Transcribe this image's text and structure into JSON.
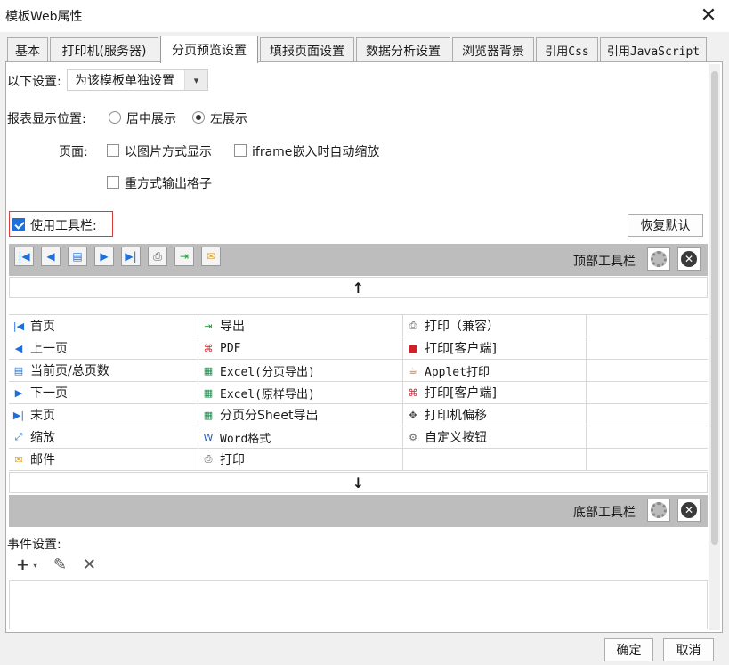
{
  "window": {
    "title": "模板Web属性",
    "close_symbol": "✕"
  },
  "tabs": [
    {
      "label": "基本"
    },
    {
      "label": "打印机(服务器)"
    },
    {
      "label": "分页预览设置",
      "active": true
    },
    {
      "label": "填报页面设置"
    },
    {
      "label": "数据分析设置"
    },
    {
      "label": "浏览器背景"
    },
    {
      "label": "引用Css"
    },
    {
      "label": "引用JavaScript"
    }
  ],
  "settings": {
    "scope_label": "以下设置:",
    "scope_value": "为该模板单独设置",
    "position_label": "报表显示位置:",
    "position_options": [
      "居中展示",
      "左展示"
    ],
    "position_selected": "左展示",
    "page_label": "页面:",
    "page_options": [
      "以图片方式显示",
      "iframe嵌入时自动缩放",
      "重方式输出格子"
    ],
    "use_toolbar_label": "使用工具栏:",
    "use_toolbar_checked": true,
    "restore_default": "恢复默认"
  },
  "top_toolbar": {
    "label": "顶部工具栏",
    "icons": [
      "first-page-icon",
      "prev-page-icon",
      "page-count-icon",
      "next-page-icon",
      "last-page-icon",
      "print-icon",
      "export-icon",
      "email-icon"
    ]
  },
  "bottom_toolbar": {
    "label": "底部工具栏"
  },
  "arrows": {
    "up": "↑",
    "down": "↓"
  },
  "buttons": {
    "col1": [
      {
        "label": "首页",
        "icon": "first-page-icon"
      },
      {
        "label": "上一页",
        "icon": "prev-page-icon"
      },
      {
        "label": "当前页/总页数",
        "icon": "page-count-icon"
      },
      {
        "label": "下一页",
        "icon": "next-page-icon"
      },
      {
        "label": "末页",
        "icon": "last-page-icon"
      },
      {
        "label": "缩放",
        "icon": "zoom-icon"
      },
      {
        "label": "邮件",
        "icon": "email-icon"
      }
    ],
    "col2": [
      {
        "label": "导出",
        "icon": "export-icon"
      },
      {
        "label": "PDF",
        "icon": "pdf-icon"
      },
      {
        "label": "Excel(分页导出)",
        "icon": "excel-icon"
      },
      {
        "label": "Excel(原样导出)",
        "icon": "excel-icon"
      },
      {
        "label": "分页分Sheet导出",
        "icon": "excel-icon"
      },
      {
        "label": "Word格式",
        "icon": "word-icon"
      },
      {
        "label": "打印",
        "icon": "print-icon"
      }
    ],
    "col3": [
      {
        "label": "打印（兼容）",
        "icon": "print-icon"
      },
      {
        "label": "打印[客户端]",
        "icon": "flash-print-icon"
      },
      {
        "label": "Applet打印",
        "icon": "applet-print-icon"
      },
      {
        "label": "打印[客户端]",
        "icon": "pdf-print-icon"
      },
      {
        "label": "打印机偏移",
        "icon": "move-icon"
      },
      {
        "label": "自定义按钮",
        "icon": "gear-icon"
      },
      {
        "label": "",
        "icon": ""
      }
    ]
  },
  "events": {
    "label": "事件设置:",
    "add": "+",
    "add_caret": "▾",
    "edit": "✎",
    "delete": "✕"
  },
  "footer": {
    "ok": "确定",
    "cancel": "取消"
  },
  "colors": {
    "accent": "#1e6fd9",
    "highlight_border": "#d93a3a",
    "toolbar_gray": "#bdbdbd"
  }
}
